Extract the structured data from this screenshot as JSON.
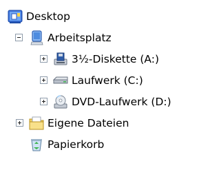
{
  "tree": {
    "desktop": {
      "label": "Desktop",
      "icon": "desktop-icon"
    },
    "arbeitsplatz": {
      "label": "Arbeitsplatz",
      "icon": "my-computer-icon",
      "state": "expanded"
    },
    "floppy": {
      "label": "3½-Diskette (A:)",
      "icon": "floppy-drive-icon",
      "state": "collapsed"
    },
    "laufwerk_c": {
      "label": "Laufwerk (C:)",
      "icon": "hard-drive-icon",
      "state": "collapsed"
    },
    "dvd": {
      "label": "DVD-Laufwerk (D:)",
      "icon": "dvd-drive-icon",
      "state": "collapsed"
    },
    "eigene_dateien": {
      "label": "Eigene Dateien",
      "icon": "my-documents-folder-icon",
      "state": "collapsed"
    },
    "papierkorb": {
      "label": "Papierkorb",
      "icon": "recycle-bin-icon"
    }
  }
}
